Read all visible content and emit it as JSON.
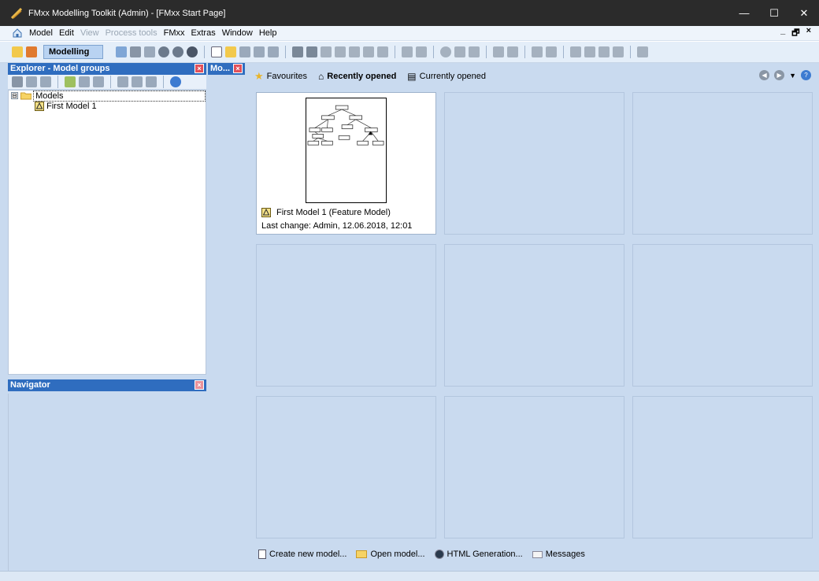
{
  "window": {
    "title": "FMxx Modelling Toolkit (Admin) - [FMxx Start Page]",
    "minimize": "—",
    "maximize": "☐",
    "close": "✕"
  },
  "menu": {
    "items": [
      {
        "label": "Model",
        "disabled": false
      },
      {
        "label": "Edit",
        "disabled": false
      },
      {
        "label": "View",
        "disabled": true
      },
      {
        "label": "Process tools",
        "disabled": true
      },
      {
        "label": "FMxx",
        "disabled": false
      },
      {
        "label": "Extras",
        "disabled": false
      },
      {
        "label": "Window",
        "disabled": false
      },
      {
        "label": "Help",
        "disabled": false
      }
    ],
    "mdi_minimize": "_",
    "mdi_restore": "🗗",
    "mdi_close": "×"
  },
  "toolbar": {
    "mode": "Modelling"
  },
  "explorer": {
    "title": "Explorer - Model groups",
    "close": "×",
    "tree": [
      {
        "label": "Models",
        "expander": "⊟"
      },
      {
        "label": "First Model 1"
      }
    ]
  },
  "mo_tab": {
    "label": "Mo...",
    "close": "×"
  },
  "navigator": {
    "title": "Navigator",
    "close": "×"
  },
  "start_page": {
    "tabs": [
      {
        "label": "Favourites",
        "active": false
      },
      {
        "label": "Recently opened",
        "active": true
      },
      {
        "label": "Currently opened",
        "active": false
      }
    ],
    "recent": {
      "name": "First Model 1 (Feature Model)",
      "last_change": "Last change: Admin, 12.06.2018, 12:01"
    },
    "links": [
      "Create new model...",
      "Open model...",
      "HTML Generation...",
      "Messages"
    ]
  },
  "colors": {
    "accent": "#2f6dbf",
    "workspace": "#c9daef",
    "titlebar": "#2b2b2b"
  }
}
